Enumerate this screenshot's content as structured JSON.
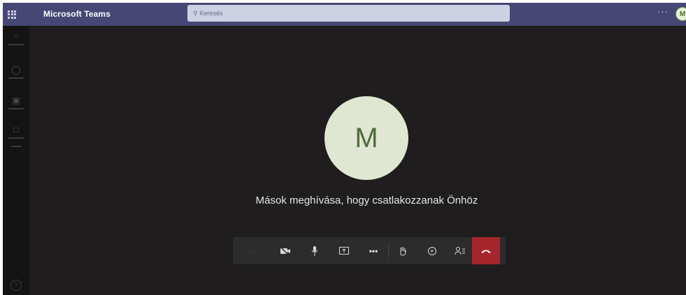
{
  "header": {
    "app_title": "Microsoft Teams",
    "search_placeholder": "Keresés",
    "more_label": "···",
    "user_initial": "M"
  },
  "rail": {
    "items": [
      {
        "icon": "activity-icon"
      },
      {
        "icon": "chat-icon"
      },
      {
        "icon": "teams-icon"
      },
      {
        "icon": "files-icon"
      }
    ],
    "help_icon": "help-icon"
  },
  "meeting": {
    "participant_initial": "M",
    "invite_text": "Mások meghívása, hogy csatlakozzanak Önhöz",
    "timer": "··:··",
    "controls": [
      "camera-icon",
      "microphone-icon",
      "share-screen-icon",
      "more-actions-icon",
      "raise-hand-icon",
      "chat-icon",
      "participants-icon",
      "hang-up-icon"
    ]
  },
  "colors": {
    "titlebar": "#464775",
    "stage": "#1f1d1d",
    "avatar_bg": "#dfe7d2",
    "hangup": "#a4262c"
  }
}
